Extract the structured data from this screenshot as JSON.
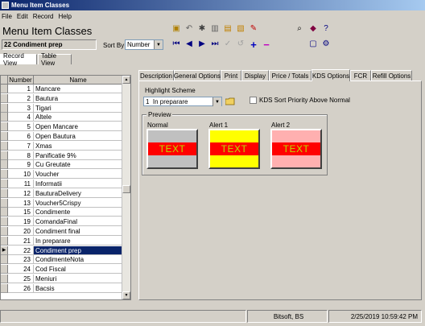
{
  "window": {
    "title": "Menu Item Classes"
  },
  "menubar": [
    "File",
    "Edit",
    "Record",
    "Help"
  ],
  "header": {
    "form_title": "Menu Item Classes",
    "current_record": "22 Condiment prep",
    "sort_by_label": "Sort By",
    "sort_by_value": "Number"
  },
  "toolbar_icons": [
    "new-record-icon",
    "undo-icon",
    "find-icon",
    "delete-icon",
    "copy-icon",
    "paste-icon",
    "clear-icon",
    "first-record-icon",
    "previous-record-icon",
    "next-record-icon",
    "last-record-icon",
    "check-icon",
    "revert-icon",
    "add-icon",
    "remove-icon",
    "binoculars-icon",
    "book-icon",
    "help-pointer-icon",
    "window-icon",
    "settings-gear-icon"
  ],
  "view_tabs": [
    "Record View",
    "Table View"
  ],
  "grid": {
    "columns": [
      "Number",
      "Name"
    ],
    "rows": [
      {
        "number": "1",
        "name": "Mancare"
      },
      {
        "number": "2",
        "name": "Bautura"
      },
      {
        "number": "3",
        "name": "Tigari"
      },
      {
        "number": "4",
        "name": "Altele"
      },
      {
        "number": "5",
        "name": "Open Mancare"
      },
      {
        "number": "6",
        "name": "Open Bautura"
      },
      {
        "number": "7",
        "name": "Xmas"
      },
      {
        "number": "8",
        "name": "Panificatie 9%"
      },
      {
        "number": "9",
        "name": "Cu Greutate"
      },
      {
        "number": "10",
        "name": "Voucher"
      },
      {
        "number": "11",
        "name": "Informatii"
      },
      {
        "number": "12",
        "name": "BauturaDelivery"
      },
      {
        "number": "13",
        "name": "Voucher5Crispy"
      },
      {
        "number": "15",
        "name": "Condimente"
      },
      {
        "number": "19",
        "name": "ComandaFinal"
      },
      {
        "number": "20",
        "name": "Condiment final"
      },
      {
        "number": "21",
        "name": "In preparare"
      },
      {
        "number": "22",
        "name": "Condiment prep"
      },
      {
        "number": "23",
        "name": "CondimenteNota"
      },
      {
        "number": "24",
        "name": "Cod Fiscal"
      },
      {
        "number": "25",
        "name": "Meniuri"
      },
      {
        "number": "26",
        "name": "Bacsis"
      }
    ],
    "selected_number": "22"
  },
  "detail_tabs": [
    "Description",
    "General Options",
    "Print",
    "Display",
    "Price / Totals",
    "KDS Options",
    "FCR",
    "Refill Options"
  ],
  "active_tab": "KDS Options",
  "kds": {
    "highlight_scheme_label": "Highlight Scheme",
    "highlight_scheme_value": "1  In preparare",
    "sort_priority_label": "KDS Sort Priority Above Normal",
    "sort_priority_checked": false,
    "preview_label": "Preview",
    "previews": [
      {
        "label": "Normal",
        "text": "TEXT",
        "background": "#c0c0c0"
      },
      {
        "label": "Alert 1",
        "text": "TEXT",
        "background": "#ffff00"
      },
      {
        "label": "Alert 2",
        "text": "TEXT",
        "background": "#ffb0b0"
      }
    ]
  },
  "status": {
    "user": "Bitsoft, BS",
    "datetime": "2/25/2019 10:59:42 PM"
  }
}
